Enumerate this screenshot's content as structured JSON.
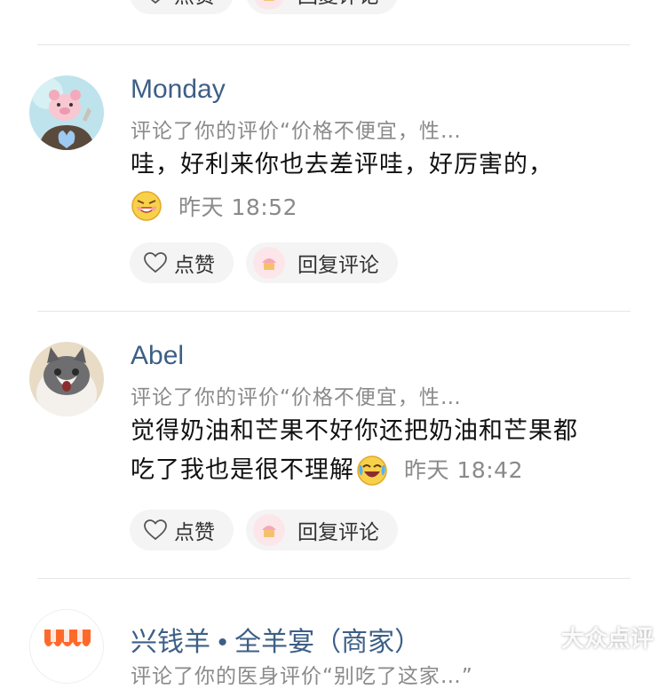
{
  "top_partial": {
    "like_label": "点赞",
    "reply_label": "回复评论"
  },
  "comments": [
    {
      "name": "Monday",
      "ref": "评论了你的评价“价格不便宜，性…",
      "text": "哇，好利来你也去差评哇，好厉害的，",
      "time": "昨天 18:52",
      "like_label": "点赞",
      "reply_label": "回复评论"
    },
    {
      "name": "Abel",
      "ref": "评论了你的评价“价格不便宜，性…",
      "text_line1": "觉得奶油和芒果不好你还把奶油和芒果都",
      "text_line2": "吃了我也是很不理解",
      "time": "昨天 18:42",
      "like_label": "点赞",
      "reply_label": "回复评论"
    },
    {
      "name": "兴钱羊 • 全羊宴（商家）",
      "ref": "评论了你的医身评价“别吃了这家…”"
    }
  ],
  "watermark": {
    "text": "大众点评"
  },
  "colors": {
    "name": "#3d5f86",
    "meta": "#8a8a8a",
    "pill_bg": "#f4f4f4",
    "divider": "#e6e6e6"
  }
}
